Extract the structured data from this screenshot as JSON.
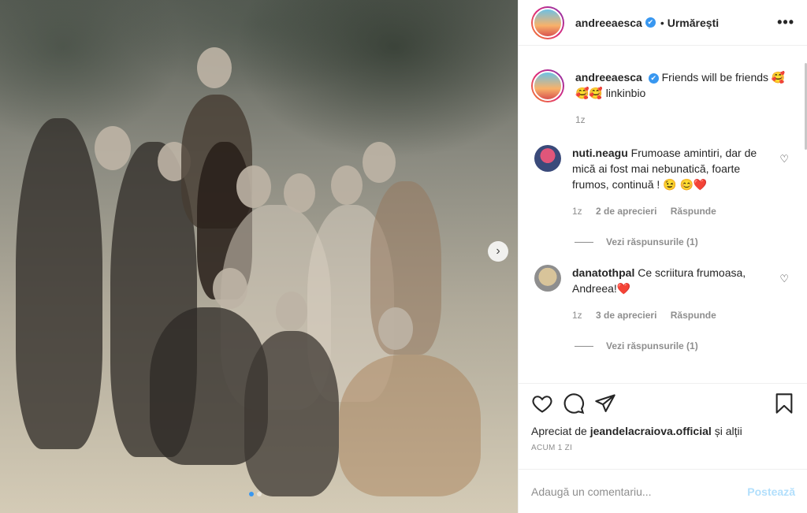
{
  "post": {
    "image_alt": "",
    "carousel_dots": 2,
    "active_dot": 0
  },
  "header": {
    "username": "andreeaesca",
    "verified_mark": "✔",
    "separator": "•",
    "follow_status": "Urmărești",
    "more": "•••"
  },
  "caption": {
    "username": "andreeaesca",
    "text": "Friends will be friends 🥰🥰🥰 linkinbio",
    "time": "1z"
  },
  "comments": [
    {
      "username": "nuti.neagu",
      "text": "Frumoase amintiri, dar de mică ai fost mai nebunatică, foarte frumos, continuă ! 😉 😊❤️",
      "time": "1z",
      "likes": "2 de aprecieri",
      "reply": "Răspunde",
      "view_replies": "Vezi răspunsurile (1)"
    },
    {
      "username": "danatothpal",
      "text": "Ce scriitura frumoasa, Andreea!❤️",
      "time": "1z",
      "likes": "3 de aprecieri",
      "reply": "Răspunde",
      "view_replies": "Vezi răspunsurile (1)"
    }
  ],
  "actions": {
    "liked_prefix": "Apreciat de",
    "liked_user": "jeandelacraiova.official",
    "liked_suffix": "și alții",
    "timestamp": "ACUM 1 ZI"
  },
  "add_comment": {
    "placeholder": "Adaugă un comentariu...",
    "post_label": "Postează"
  },
  "colors": {
    "accent": "#3897f0",
    "post_disabled": "#b2dffc",
    "muted": "#8e8e8e"
  }
}
